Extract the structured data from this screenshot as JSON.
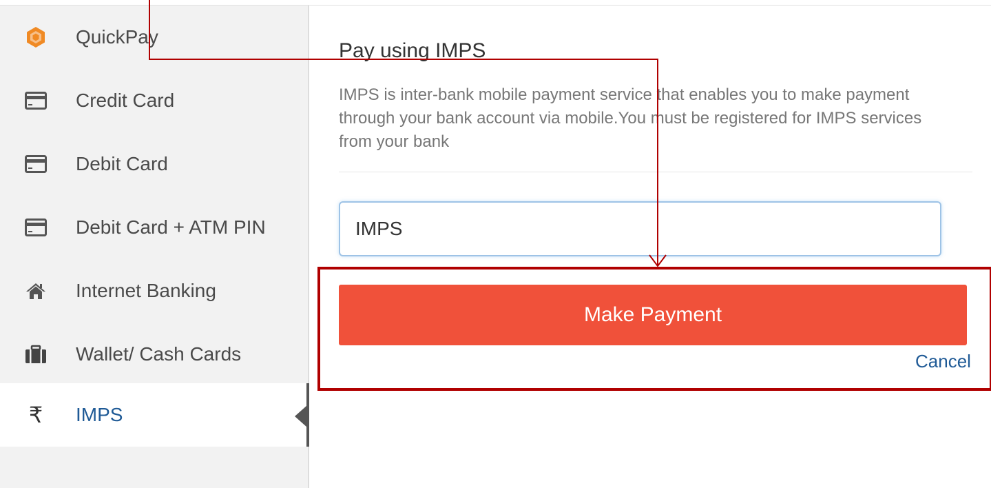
{
  "sidebar": {
    "items": [
      {
        "label": "QuickPay",
        "icon": "quickpay-hexagon-icon",
        "active": false
      },
      {
        "label": "Credit Card",
        "icon": "credit-card-icon",
        "active": false
      },
      {
        "label": "Debit Card",
        "icon": "debit-card-icon",
        "active": false
      },
      {
        "label": "Debit Card + ATM PIN",
        "icon": "debit-card-atm-icon",
        "active": false
      },
      {
        "label": "Internet Banking",
        "icon": "home-icon",
        "active": false
      },
      {
        "label": "Wallet/ Cash Cards",
        "icon": "wallet-briefcase-icon",
        "active": false
      },
      {
        "label": "IMPS",
        "icon": "rupee-icon",
        "active": true
      }
    ]
  },
  "main": {
    "title": "Pay using IMPS",
    "description": "IMPS is inter-bank mobile payment service that enables you to make payment through your bank account via mobile.You must be registered for IMPS services from your bank",
    "input_value": "IMPS",
    "pay_button_label": "Make Payment",
    "cancel_label": "Cancel"
  },
  "colors": {
    "accent_button": "#f0513a",
    "link": "#1f5a96",
    "annotation_red": "#b00000",
    "quickpay_orange": "#f08a24"
  }
}
